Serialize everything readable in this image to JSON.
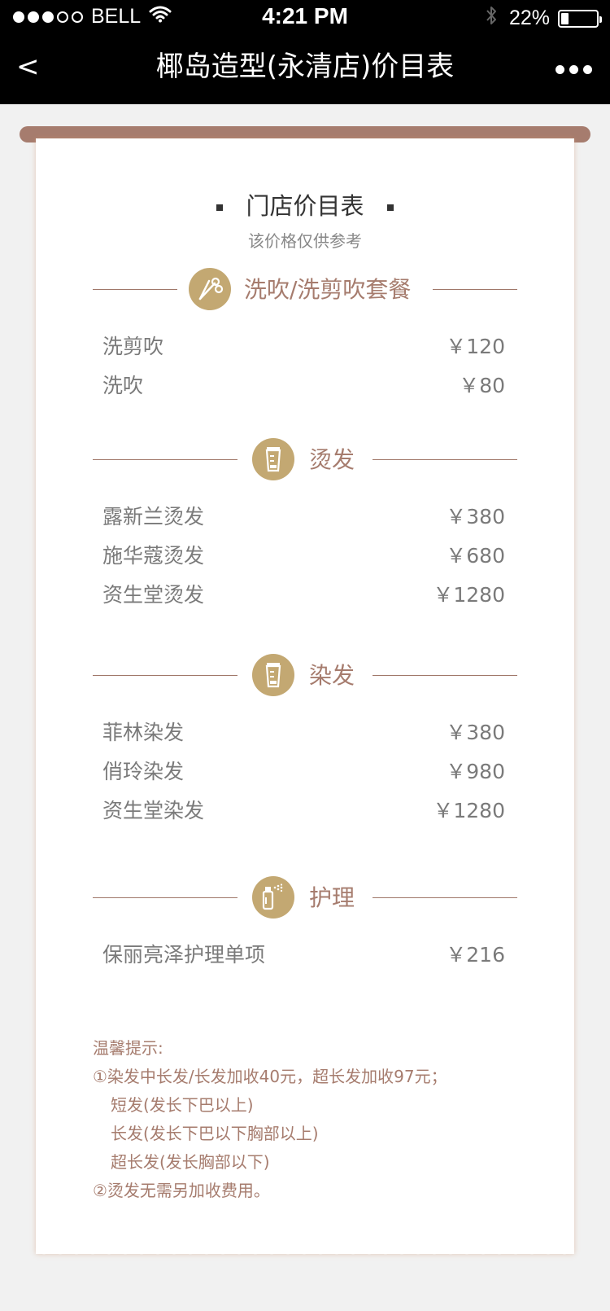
{
  "status_bar": {
    "carrier": "BELL",
    "time": "4:21 PM",
    "battery": "22%",
    "battery_level": 0.22,
    "signal_full": 3,
    "signal_total": 5
  },
  "nav": {
    "back_label": "<",
    "title": "椰岛造型(永清店)价目表"
  },
  "menu": {
    "title": "门店价目表",
    "subtitle": "该价格仅供参考",
    "sections": [
      {
        "label": "洗吹/洗剪吹套餐",
        "icon": "scissors-icon",
        "items": [
          {
            "name": "洗剪吹",
            "price": "￥120"
          },
          {
            "name": "洗吹",
            "price": "￥80"
          }
        ]
      },
      {
        "label": "烫发",
        "icon": "hair-product-tube-icon",
        "items": [
          {
            "name": "露新兰烫发",
            "price": "￥380"
          },
          {
            "name": "施华蔻烫发",
            "price": "￥680"
          },
          {
            "name": "资生堂烫发",
            "price": "￥1280"
          }
        ]
      },
      {
        "label": "染发",
        "icon": "hair-product-tube-icon",
        "items": [
          {
            "name": "菲林染发",
            "price": "￥380"
          },
          {
            "name": "俏玲染发",
            "price": "￥980"
          },
          {
            "name": "资生堂染发",
            "price": "￥1280"
          }
        ]
      },
      {
        "label": "护理",
        "icon": "spray-bottle-icon",
        "items": [
          {
            "name": "保丽亮泽护理单项",
            "price": "￥216"
          }
        ]
      }
    ]
  },
  "notice": {
    "heading": "温馨提示:",
    "lines": [
      "①染发中长发/长发加收40元，超长发加收97元；",
      "短发(发长下巴以上)",
      "长发(发长下巴以下胸部以上)",
      "超长发(发长胸部以下)",
      "②烫发无需另加收费用。"
    ]
  },
  "colors": {
    "accent": "#a67c6e",
    "icon_bg": "#c3a872",
    "bar_bg": "#000000",
    "page_bg": "#f1f1f1"
  }
}
